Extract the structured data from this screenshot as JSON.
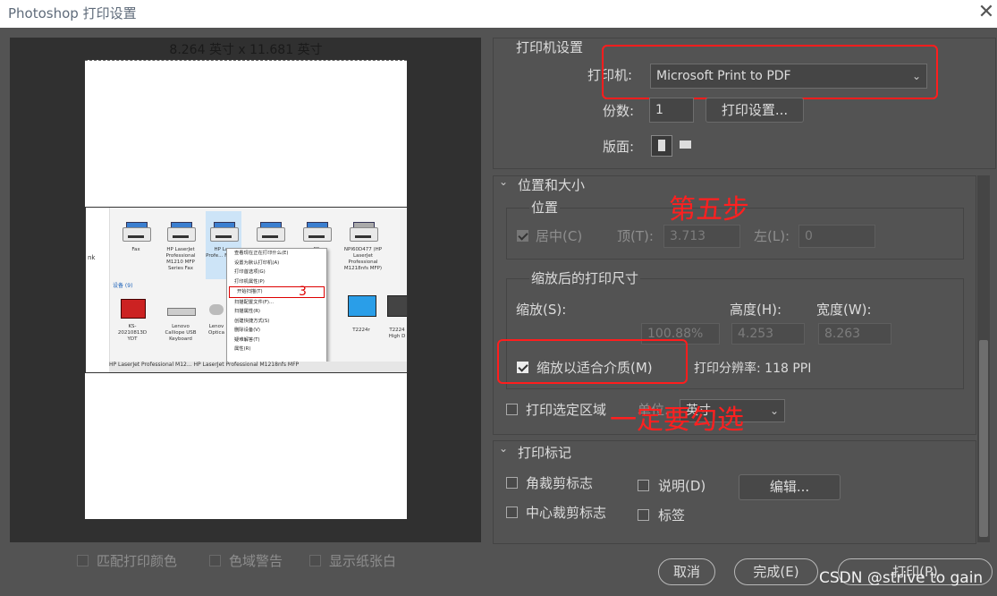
{
  "window": {
    "title": "Photoshop 打印设置",
    "close_icon": "close-icon"
  },
  "preview": {
    "size_label": "8.264 英寸 x 11.681 英寸",
    "screenshot": {
      "left_label": "nk",
      "devices_row1": [
        {
          "name": "Fax"
        },
        {
          "name": "HP LaserJet Professional M1210 MFP Series Fax"
        },
        {
          "name": "HP La... Profe... M1218"
        },
        {
          "name": ""
        },
        {
          "name": "PS"
        },
        {
          "name": "NPI60D477 (HP LaserJet Professional M1218nfs MFP)"
        }
      ],
      "group_label": "设备 (9)",
      "devices_row2": [
        {
          "name": "KS-20210813D YDT"
        },
        {
          "name": "Lenovo Calliope USB Keyboard"
        },
        {
          "name": "Lenov Optica"
        },
        {
          "name": "T2224r"
        },
        {
          "name": "T2224 High D"
        }
      ],
      "context_menu": [
        "查看现在正在打印什么(E)",
        "设置为默认打印机(A)",
        "打印首选项(G)",
        "打印机属性(P)",
        "开始扫描(T)",
        "扫描配置文件(F)...",
        "扫描属性(R)",
        "创建快捷方式(S)",
        "删除设备(V)",
        "疑难解答(T)",
        "属性(R)"
      ],
      "annotation_number": "3",
      "status_bar": "HP LaserJet Professional M12... HP LaserJet Professional M1218nfs MFP"
    },
    "bottom_checks": [
      {
        "label": "匹配打印颜色",
        "checked": false
      },
      {
        "label": "色域警告",
        "checked": false
      },
      {
        "label": "显示纸张白",
        "checked": false
      }
    ]
  },
  "printer_settings": {
    "section": "打印机设置",
    "printer_label": "打印机:",
    "printer_value": "Microsoft Print to PDF",
    "copies_label": "份数:",
    "copies_value": "1",
    "print_settings_button": "打印设置...",
    "layout_label": "版面:"
  },
  "position_size": {
    "section": "位置和大小",
    "position_group": "位置",
    "center_label": "居中(C)",
    "center_checked": true,
    "top_label": "顶(T):",
    "top_value": "3.713",
    "left_label": "左(L):",
    "left_value": "0",
    "scaled_group": "缩放后的打印尺寸",
    "scale_label": "缩放(S):",
    "height_label": "高度(H):",
    "width_label": "宽度(W):",
    "scale_value": "100.88%",
    "height_value": "4.253",
    "width_value": "8.263",
    "fit_media_label": "缩放以适合介质(M)",
    "fit_media_checked": true,
    "resolution_text": "打印分辨率: 118 PPI",
    "print_selection_label": "打印选定区域",
    "print_selection_checked": false,
    "unit_label": "单位:",
    "unit_value": "英寸"
  },
  "print_marks": {
    "section": "打印标记",
    "corner_crop": "角裁剪标志",
    "center_crop": "中心裁剪标志",
    "description": "说明(D)",
    "labels": "标签",
    "edit_button": "编辑..."
  },
  "annotations": {
    "step_five": "第五步",
    "must_check": "一定要勾选"
  },
  "footer": {
    "cancel": "取消",
    "done": "完成(E)",
    "print": "打印(P)"
  },
  "watermark": "CSDN @strive to gain",
  "colors": {
    "background": "#535353",
    "annotation_red": "#ff1d1d"
  }
}
